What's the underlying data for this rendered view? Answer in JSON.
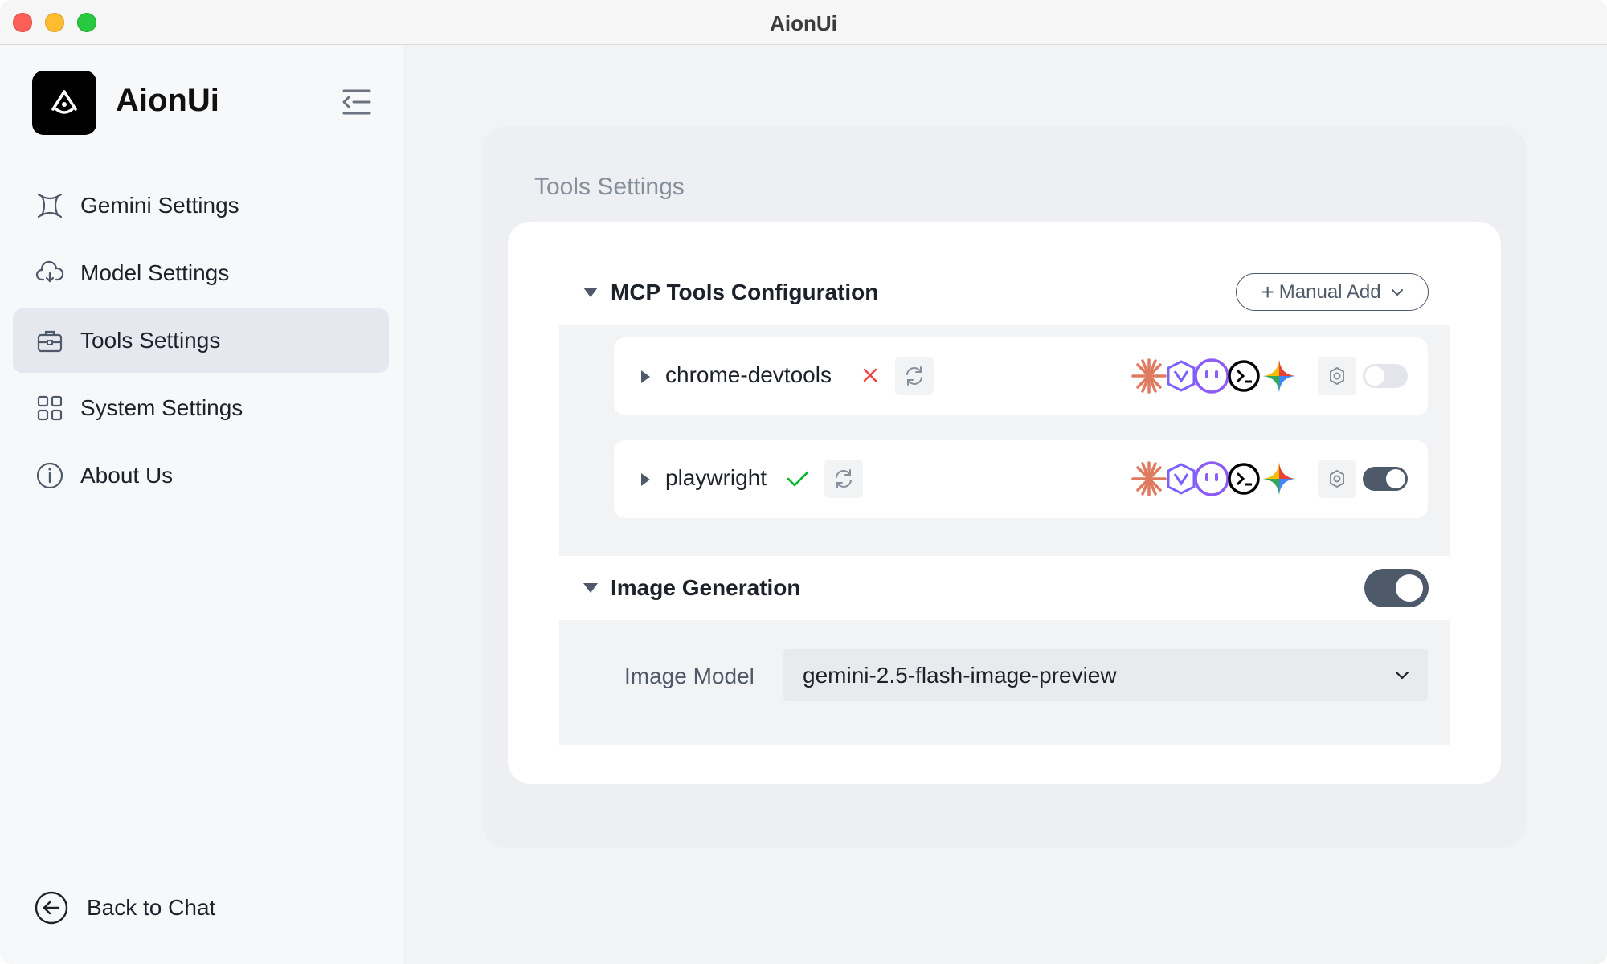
{
  "window": {
    "title": "AionUi"
  },
  "sidebar": {
    "app_name": "AionUi",
    "items": [
      {
        "label": "Gemini Settings",
        "icon": "gemini-icon"
      },
      {
        "label": "Model Settings",
        "icon": "cloud-icon"
      },
      {
        "label": "Tools Settings",
        "icon": "toolbox-icon",
        "active": true
      },
      {
        "label": "System Settings",
        "icon": "grid-icon"
      },
      {
        "label": "About Us",
        "icon": "info-icon"
      }
    ],
    "back": {
      "label": "Back to Chat",
      "icon": "arrow-left-circle-icon"
    }
  },
  "main": {
    "section_title": "Tools Settings",
    "mcp": {
      "title": "MCP Tools Configuration",
      "manual_add_label": "Manual Add",
      "tools": [
        {
          "name": "chrome-devtools",
          "status": "error",
          "enabled": false
        },
        {
          "name": "playwright",
          "status": "ok",
          "enabled": true
        }
      ]
    },
    "image_generation": {
      "title": "Image Generation",
      "enabled": true,
      "model_label": "Image Model",
      "model_value": "gemini-2.5-flash-image-preview"
    }
  },
  "colors": {
    "accent": "#4e5969",
    "error": "#f53f3f",
    "success": "#00b42a"
  }
}
